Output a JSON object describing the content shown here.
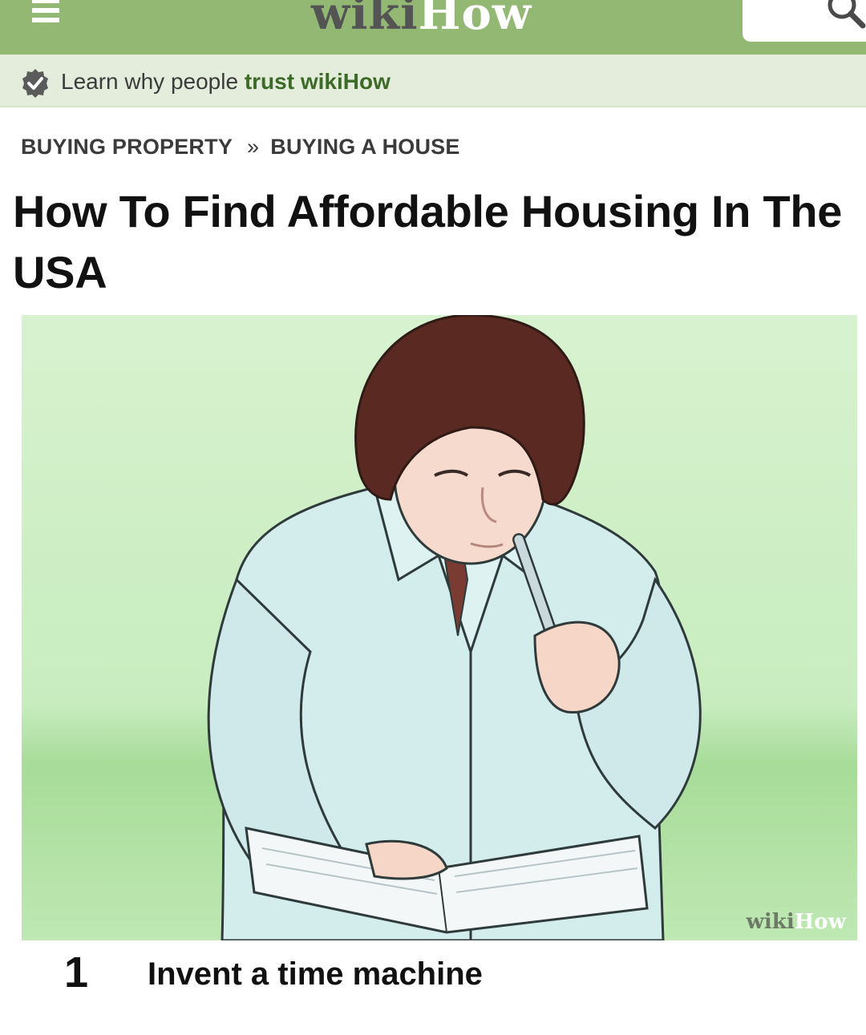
{
  "header": {
    "logo_wiki": "wiki",
    "logo_how": "How",
    "background_color": "#93b874"
  },
  "trust_bar": {
    "text_prefix": "Learn why people",
    "text_link": "trust wikiHow",
    "background_color": "#e4eddb"
  },
  "breadcrumb": {
    "items": [
      "BUYING PROPERTY",
      "BUYING A HOUSE"
    ],
    "separator": "»"
  },
  "article": {
    "title": "How To Find Affordable Housing In The USA"
  },
  "image": {
    "watermark_wiki": "wiki",
    "watermark_how": "How",
    "background_color": "#cdeec4"
  },
  "step": {
    "number": "1",
    "text": "Invent a time machine"
  },
  "icons": {
    "menu": "hamburger-menu-icon",
    "search": "search-icon",
    "trust": "verified-check-icon"
  }
}
